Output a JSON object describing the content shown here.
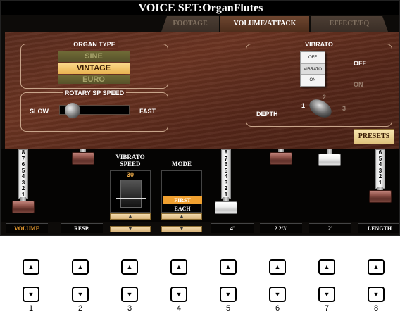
{
  "title": "VOICE SET:OrganFlutes",
  "tabs": [
    "FOOTAGE",
    "VOLUME/ATTACK",
    "EFFECT/EQ"
  ],
  "organ_type": {
    "label": "ORGAN TYPE",
    "options": [
      "SINE",
      "VINTAGE",
      "EURO"
    ],
    "selected": "VINTAGE"
  },
  "rotary": {
    "label": "ROTARY SP SPEED",
    "slow": "SLOW",
    "fast": "FAST"
  },
  "vibrato": {
    "label": "VIBRATO",
    "switch_off": "OFF",
    "switch_mid": "VIBRATO",
    "switch_on": "ON",
    "state_off": "OFF",
    "state_on": "ON",
    "depth_label": "DEPTH",
    "depth_marks": [
      "1",
      "2",
      "3"
    ]
  },
  "presets_label": "PRESETS",
  "drawbar_numbers": [
    "8",
    "7",
    "6",
    "5",
    "4",
    "3",
    "2",
    "1"
  ],
  "drawbar_numbers_short": [
    "6",
    "5",
    "4",
    "3",
    "2",
    "1"
  ],
  "vibrato_speed": {
    "heading_line1": "VIBRATO",
    "heading_line2": "SPEED",
    "value": "30"
  },
  "mode": {
    "heading": "MODE",
    "first": "FIRST",
    "each": "EACH"
  },
  "arrow_up": "▲",
  "arrow_down": "▼",
  "bottom_labels": [
    "VOLUME",
    "RESP.",
    "",
    "",
    "4'",
    "2 2/3'",
    "2'",
    "LENGTH"
  ],
  "panel_buttons": {
    "up_symbol": "▲",
    "down_symbol": "▼",
    "numbers": [
      "1",
      "2",
      "3",
      "4",
      "5",
      "6",
      "7",
      "8"
    ]
  },
  "colors": {
    "accent": "#f0a030",
    "wood": "#5f2e1f"
  }
}
